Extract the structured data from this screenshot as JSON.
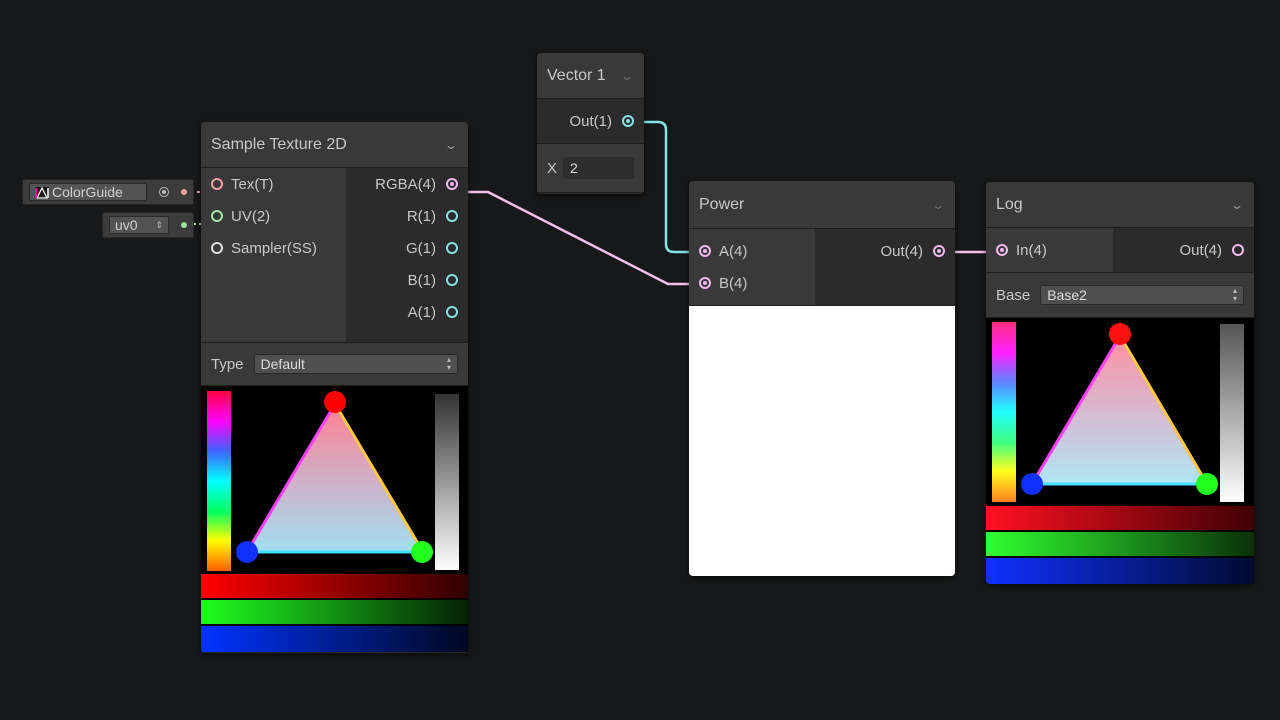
{
  "colors": {
    "background": "#171819",
    "texture_port": "#f0a0a0",
    "vector2_port": "#9ee69e",
    "vector1_port": "#84e4e7",
    "vector4_port": "#f4b8f0",
    "sampler_port": "#dcdcdc"
  },
  "inline_inputs": {
    "texture": {
      "value": "ColorGuide",
      "icon": "texture-thumbnail-icon",
      "picker_icon": "object-picker-icon"
    },
    "uv": {
      "value": "uv0",
      "arrows": "⇕"
    }
  },
  "sample_texture": {
    "title": "Sample Texture 2D",
    "inputs": [
      "Tex(T)",
      "UV(2)",
      "Sampler(SS)"
    ],
    "outputs": [
      "RGBA(4)",
      "R(1)",
      "G(1)",
      "B(1)",
      "A(1)"
    ],
    "type_label": "Type",
    "type_value": "Default"
  },
  "vector1": {
    "title": "Vector 1",
    "output": "Out(1)",
    "field_label": "X",
    "field_value": "2"
  },
  "power": {
    "title": "Power",
    "inputs": [
      "A(4)",
      "B(4)"
    ],
    "output": "Out(4)"
  },
  "log": {
    "title": "Log",
    "input": "In(4)",
    "output": "Out(4)",
    "base_label": "Base",
    "base_value": "Base2"
  },
  "icons": {
    "collapse": "chevron-down-icon",
    "dropdown": "dropdown-arrows-icon"
  }
}
